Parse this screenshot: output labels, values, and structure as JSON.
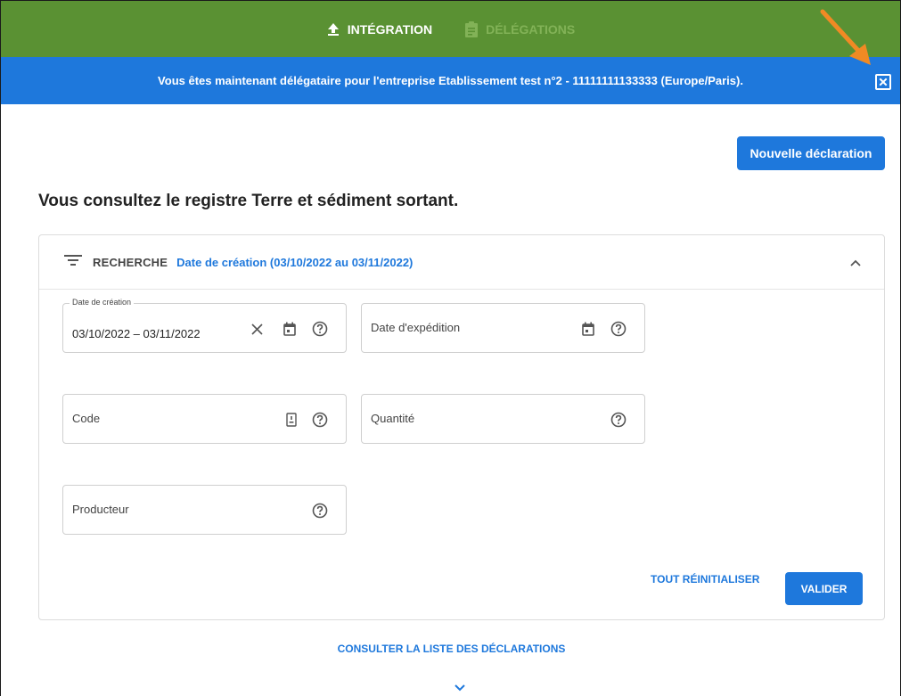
{
  "nav": {
    "tabs": [
      {
        "label": "INTÉGRATION",
        "icon": "upload-icon",
        "active": true
      },
      {
        "label": "DÉLÉGATIONS",
        "icon": "clipboard-icon",
        "active": false
      }
    ]
  },
  "banner": {
    "text": "Vous êtes maintenant délégataire pour l'entreprise Etablissement test n°2 - 11111111133333 (Europe/Paris).",
    "close_icon": "close-box-icon"
  },
  "actions": {
    "new_declaration": "Nouvelle déclaration"
  },
  "page": {
    "title": "Vous consultez le registre Terre et sédiment sortant."
  },
  "search": {
    "label": "RECHERCHE",
    "summary": "Date de création (03/10/2022 au 03/11/2022)",
    "fields": {
      "creation_date": {
        "label": "Date de création",
        "value": "03/10/2022 – 03/11/2022"
      },
      "shipping_date": {
        "label": "Date d'expédition"
      },
      "code": {
        "label": "Code"
      },
      "quantity": {
        "label": "Quantité"
      },
      "producer": {
        "label": "Producteur"
      }
    },
    "reset_label": "TOUT RÉINITIALISER",
    "validate_label": "VALIDER"
  },
  "footer": {
    "list_link": "CONSULTER LA LISTE DES DÉCLARATIONS"
  },
  "colors": {
    "nav_green": "#5a9133",
    "primary_blue": "#1e78dc",
    "annotation_orange": "#f08a24"
  }
}
